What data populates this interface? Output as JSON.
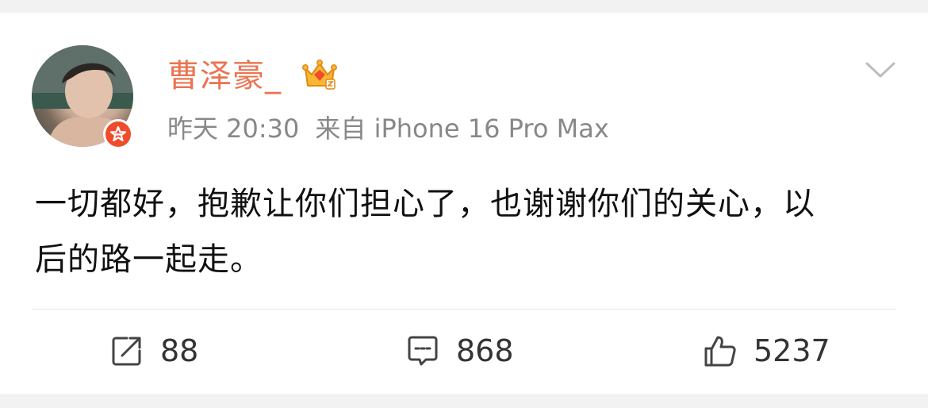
{
  "post": {
    "author": {
      "name": "曹泽豪_",
      "avatar_icon": "user-avatar",
      "verified_icon": "verified-badge-icon",
      "level_icon": "crown-icon"
    },
    "time": "昨天 20:30",
    "source": "来自 iPhone 16 Pro Max",
    "text": "一切都好，抱歉让你们担心了，也谢谢你们的关心，以后的路一起走。",
    "menu_icon": "chevron-down-icon"
  },
  "actions": {
    "repost": {
      "icon": "share-icon",
      "count": "88"
    },
    "comment": {
      "icon": "comment-icon",
      "count": "868"
    },
    "like": {
      "icon": "thumbs-up-icon",
      "count": "5237"
    }
  },
  "colors": {
    "username": "#eb7350",
    "meta": "#888888",
    "badge": "#f04c2c",
    "crown": "#f5a623"
  }
}
